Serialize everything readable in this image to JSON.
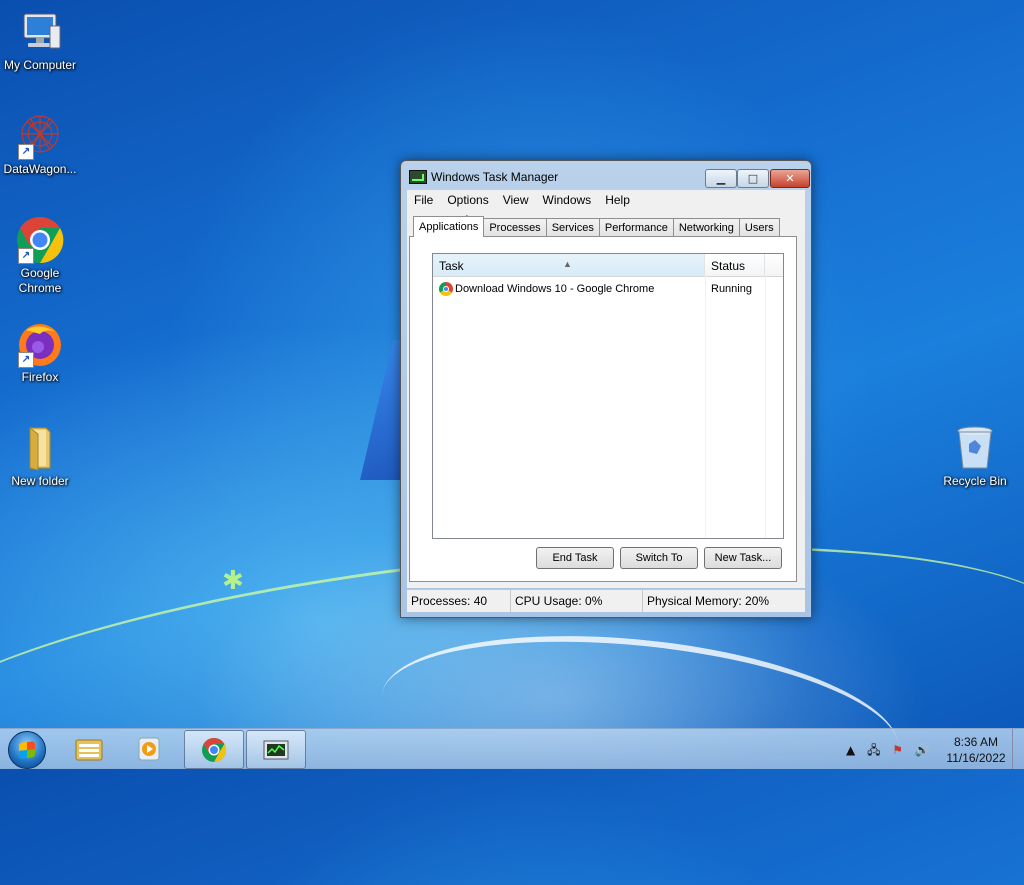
{
  "desktop": {
    "icons": [
      {
        "label": "My Computer",
        "icon": "computer-icon"
      },
      {
        "label": "DataWagon...",
        "icon": "datawagon-icon"
      },
      {
        "label": "Google Chrome",
        "icon": "chrome-icon"
      },
      {
        "label": "Firefox",
        "icon": "firefox-icon"
      },
      {
        "label": "New folder",
        "icon": "folder-icon"
      },
      {
        "label": "Recycle Bin",
        "icon": "recycle-bin-icon"
      }
    ]
  },
  "window": {
    "title": "Windows Task Manager",
    "menu": [
      "File",
      "Options",
      "View",
      "Windows",
      "Help"
    ],
    "tabs": [
      "Applications",
      "Processes",
      "Services",
      "Performance",
      "Networking",
      "Users"
    ],
    "active_tab": "Applications",
    "list": {
      "columns": [
        "Task",
        "Status"
      ],
      "rows": [
        {
          "task": "Download Windows 10 - Google Chrome",
          "status": "Running"
        }
      ]
    },
    "buttons": {
      "end_task": "End Task",
      "switch_to": "Switch To",
      "new_task": "New Task..."
    },
    "status": {
      "processes": "Processes: 40",
      "cpu": "CPU Usage: 0%",
      "memory": "Physical Memory: 20%"
    }
  },
  "taskbar": {
    "time": "8:36 AM",
    "date": "11/16/2022"
  }
}
